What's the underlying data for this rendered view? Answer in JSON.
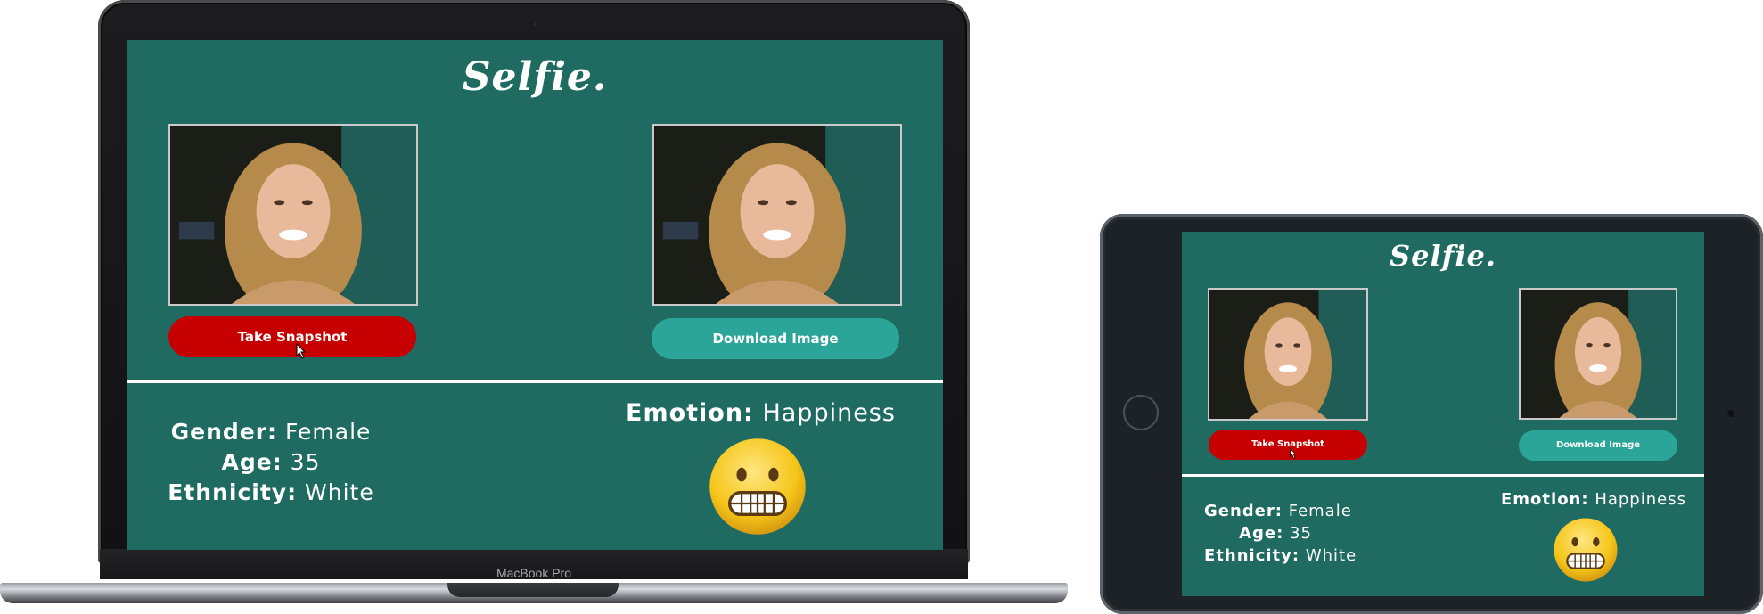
{
  "laptop": {
    "brand_label": "MacBook Pro"
  },
  "app": {
    "title": "Selfie.",
    "take_snapshot_label": "Take Snapshot",
    "download_label": "Download Image",
    "gender_label": "Gender:",
    "gender_value": "Female",
    "age_label": "Age:",
    "age_value": "35",
    "ethnicity_label": "Ethnicity:",
    "ethnicity_value": "White",
    "emotion_label": "Emotion:",
    "emotion_value": "Happiness",
    "emotion_icon": "grimacing-face-icon"
  },
  "colors": {
    "app_background": "#1f6b62",
    "snapshot_button": "#c60000",
    "download_button": "#2aa597",
    "text": "#ffffff"
  }
}
